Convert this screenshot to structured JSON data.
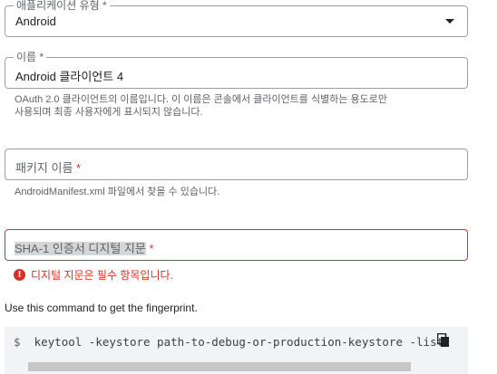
{
  "app_type": {
    "label": "애플리케이션 유형",
    "required_mark": "*",
    "value": "Android"
  },
  "name": {
    "label": "이름",
    "required_mark": "*",
    "value": "Android 클라이언트 4",
    "hint_line1": "OAuth 2.0 클라이언트의 이름입니다. 이 이름은 콘솔에서 클라이언트를 식별하는 용도로만",
    "hint_line2": "사용되며 최종 사용자에게 표시되지 않습니다."
  },
  "package": {
    "placeholder": "패키지 이름",
    "required_mark": "*",
    "hint": "AndroidManifest.xml 파일에서 찾을 수 있습니다."
  },
  "sha1": {
    "placeholder": "SHA-1 인증서 디지털 지문",
    "required_mark": "*",
    "error": "디지털 지문은 필수 항목입니다.",
    "error_icon_glyph": "!"
  },
  "command": {
    "info": "Use this command to get the fingerprint.",
    "prompt": "$",
    "text": "keytool -keystore path-to-debug-or-production-keystore -list"
  },
  "colors": {
    "error": "#d93025",
    "border": "#9aa0a6",
    "code_bg": "#f1f3f4"
  },
  "icons": {
    "dropdown": "caret-down-icon",
    "copy": "copy-icon",
    "error": "error-icon"
  }
}
